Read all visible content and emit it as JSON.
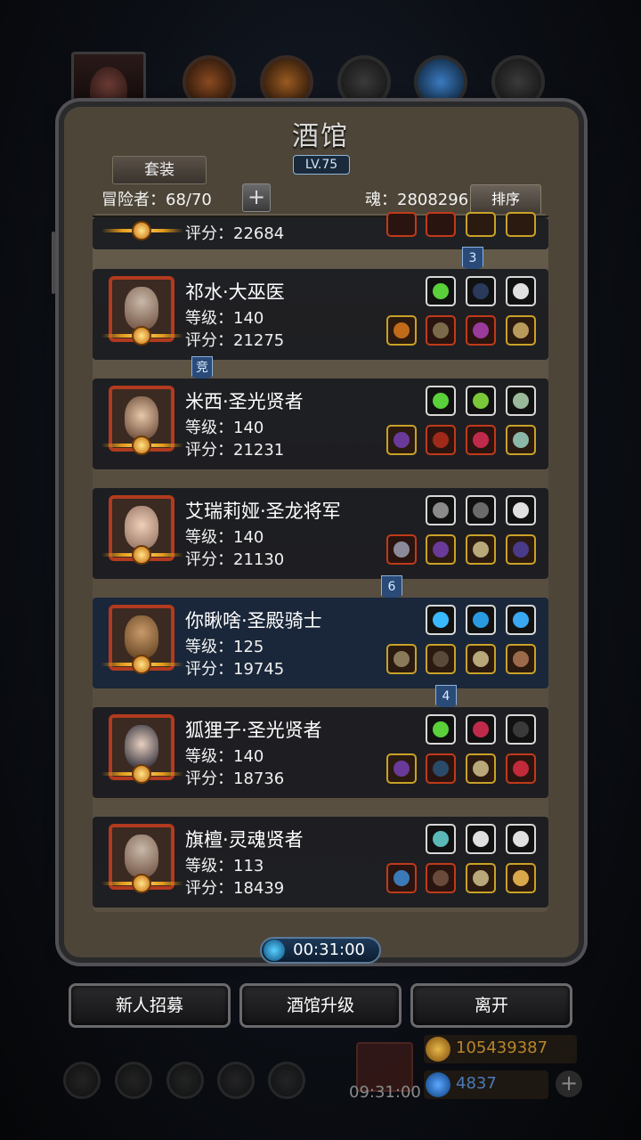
{
  "panel": {
    "title": "酒馆",
    "level": "LV.75",
    "suit_button": "套装",
    "adventurers": "冒险者：68/70",
    "add": "+",
    "soul": "魂：2808296",
    "sort_button": "排序"
  },
  "partial_card": {
    "score": "评分：22684"
  },
  "heroes": [
    {
      "name": "祁水·大巫医",
      "level": "等级：140",
      "score": "评分：21275"
    },
    {
      "name": "米西·圣光贤者",
      "level": "等级：140",
      "score": "评分：21231"
    },
    {
      "name": "艾瑞莉娅·圣龙将军",
      "level": "等级：140",
      "score": "评分：21130"
    },
    {
      "name": "你瞅啥·圣殿骑士",
      "level": "等级：125",
      "score": "评分：19745"
    },
    {
      "name": "狐狸子·圣光贤者",
      "level": "等级：140",
      "score": "评分：18736"
    },
    {
      "name": "旗檀·灵魂贤者",
      "level": "等级：113",
      "score": "评分：18439"
    }
  ],
  "rank_badges": [
    "3",
    "竞",
    "6",
    "4"
  ],
  "timer": "00:31:00",
  "buttons": {
    "recruit": "新人招募",
    "upgrade": "酒馆升级",
    "leave": "离开"
  },
  "footer": {
    "gift_timer": "09:31:00",
    "gold": "105439387",
    "gems": "4837",
    "add": "+"
  },
  "colors": {
    "rarity_red": "#c03a1a",
    "rarity_gold": "#c9a227",
    "highlight_row": "#14243a"
  }
}
